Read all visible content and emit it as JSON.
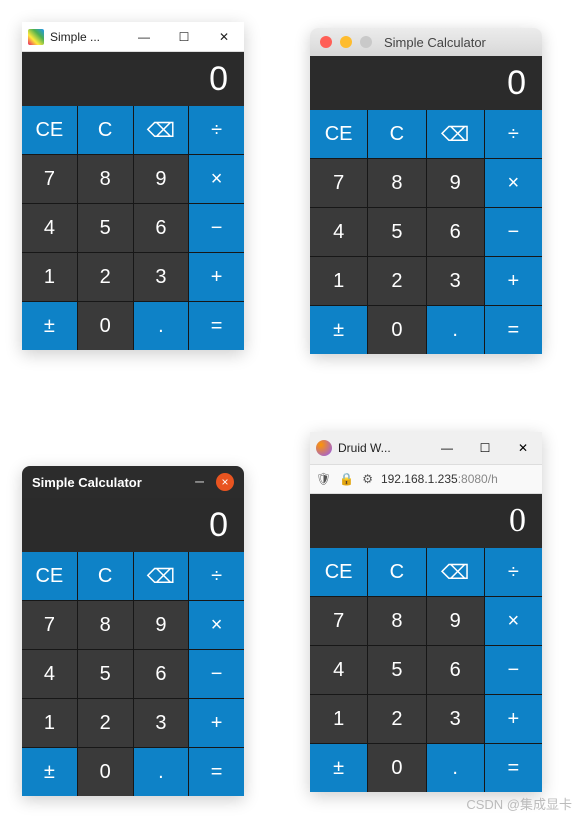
{
  "windows": {
    "win": {
      "title": "Simple ...",
      "min": "—",
      "max": "☐",
      "close": "✕"
    },
    "mac": {
      "title": "Simple Calculator"
    },
    "gnome": {
      "title": "Simple Calculator",
      "min": "–",
      "close": "×"
    },
    "ff": {
      "title": "Druid W...",
      "min": "—",
      "max": "☐",
      "close": "✕",
      "url_ip": "192.168.1.235",
      "url_port": ":8080/h"
    }
  },
  "calc": {
    "display": "0",
    "clear_entry": "CE",
    "clear": "C",
    "backspace": "⌫",
    "divide": "÷",
    "multiply": "×",
    "minus": "−",
    "plus": "+",
    "equals": "=",
    "plusminus": "±",
    "decimal": ".",
    "n0": "0",
    "n1": "1",
    "n2": "2",
    "n3": "3",
    "n4": "4",
    "n5": "5",
    "n6": "6",
    "n7": "7",
    "n8": "8",
    "n9": "9"
  },
  "watermark": "CSDN @集成显卡"
}
